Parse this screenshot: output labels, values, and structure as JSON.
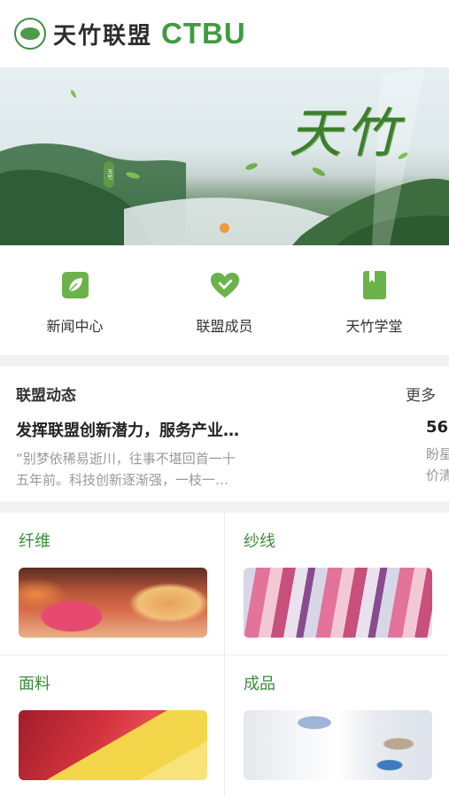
{
  "header": {
    "logo_cn": "天竹联盟",
    "logo_en": "CTBU"
  },
  "banner": {
    "title": "天竹"
  },
  "quicknav": [
    {
      "label": "新闻中心",
      "icon": "leaf-icon"
    },
    {
      "label": "联盟成员",
      "icon": "heart-icon"
    },
    {
      "label": "天竹学堂",
      "icon": "book-icon"
    }
  ],
  "news": {
    "section_title": "联盟动态",
    "more_label": "更多",
    "items": [
      {
        "title": "发挥联盟创新潜力，服务产业…",
        "summary_line1": "“别梦依稀易逝川，往事不堪回首一十",
        "summary_line2": "五年前。科技创新逐渐强，一枝一…"
      },
      {
        "title": "56",
        "summary_line1": "盼星",
        "summary_line2": "价清"
      }
    ]
  },
  "categories": [
    {
      "label": "纤维"
    },
    {
      "label": "纱线"
    },
    {
      "label": "面料"
    },
    {
      "label": "成品"
    }
  ],
  "colors": {
    "brand_green": "#3f9b3f",
    "banner_dot": "#ef9a3a"
  }
}
